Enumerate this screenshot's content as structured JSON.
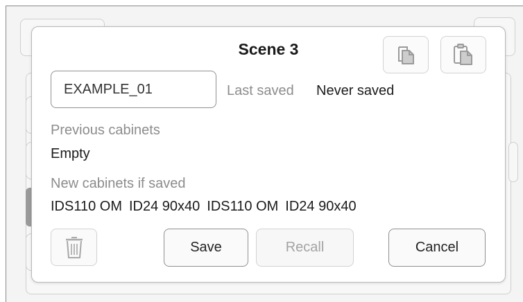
{
  "dialog": {
    "title": "Scene 3",
    "name_field": {
      "value": "EXAMPLE_01"
    },
    "last_saved_label": "Last saved",
    "last_saved_value": "Never saved",
    "previous_cabinets_label": "Previous cabinets",
    "previous_cabinets_value": "Empty",
    "new_cabinets_label": "New cabinets if saved",
    "new_cabinets": [
      "IDS110 OM",
      "ID24 90x40",
      "IDS110 OM",
      "ID24 90x40"
    ],
    "buttons": {
      "save": "Save",
      "recall": "Recall",
      "cancel": "Cancel"
    },
    "icons": {
      "copy": "copy-icon",
      "paste": "paste-icon",
      "delete": "trash-icon"
    }
  },
  "colors": {
    "muted_text": "#8c8c8c",
    "border": "#8f8f8f",
    "disabled": "#d2d2d2"
  }
}
